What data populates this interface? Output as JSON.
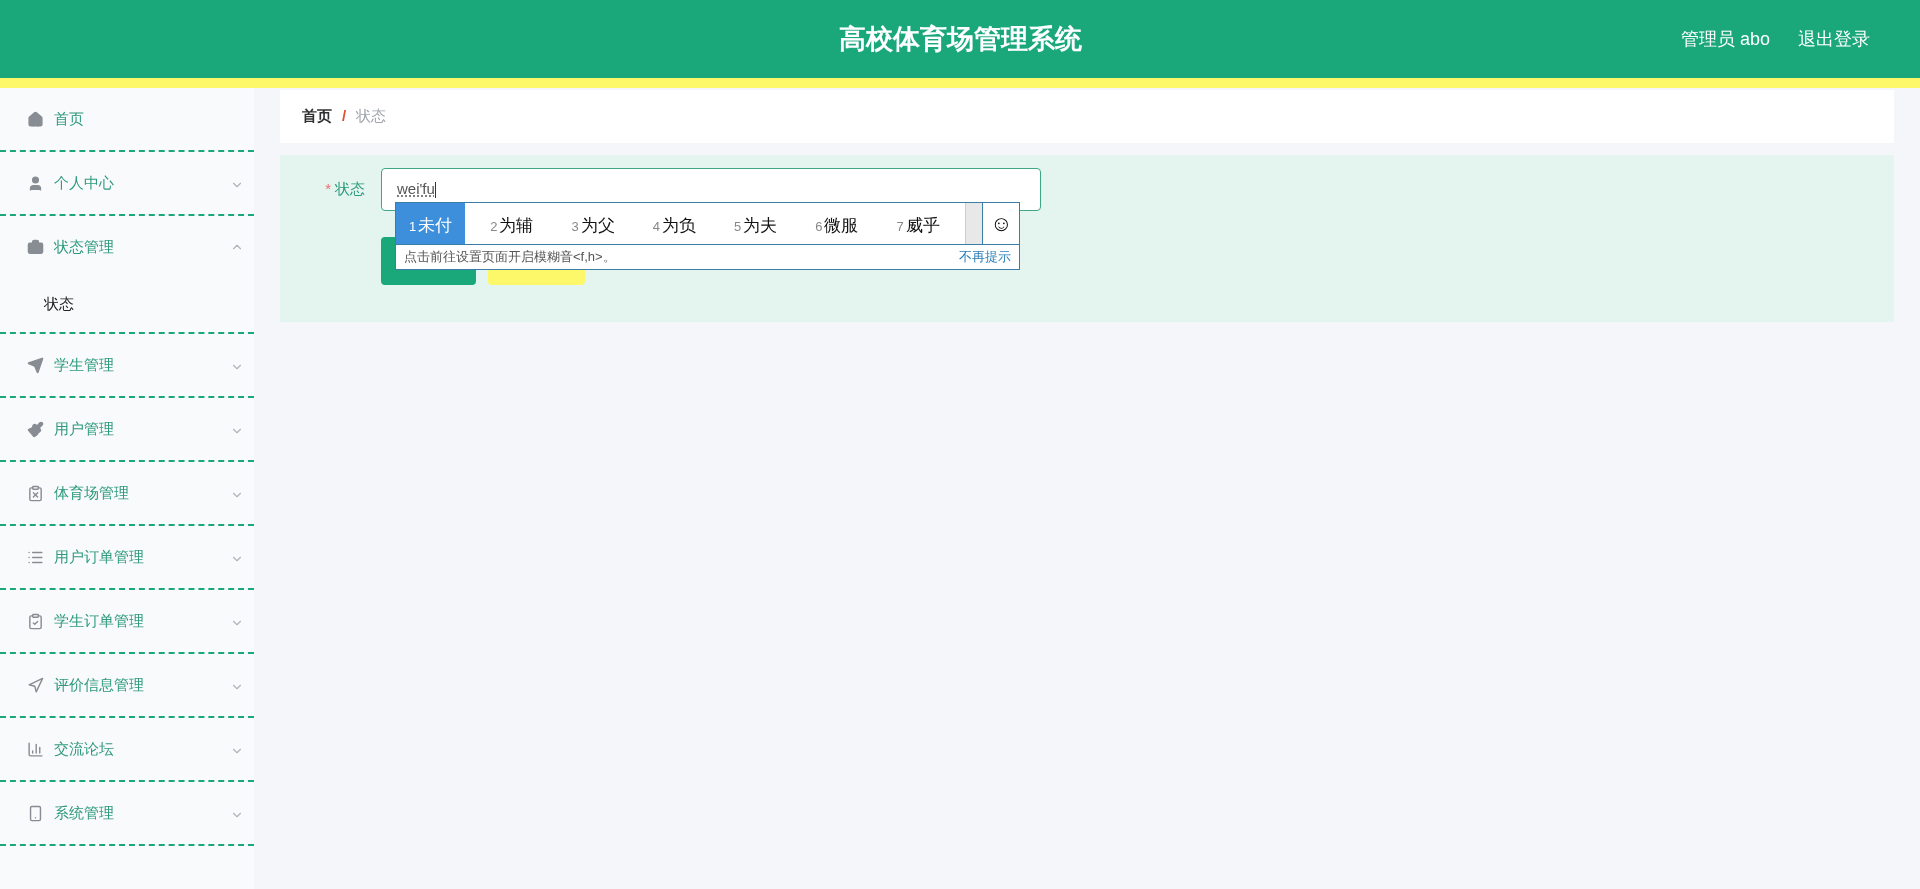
{
  "header": {
    "title": "高校体育场管理系统",
    "user": "管理员 abo",
    "logout": "退出登录"
  },
  "sidebar": {
    "items": [
      {
        "label": "首页"
      },
      {
        "label": "个人中心",
        "expanded": false
      },
      {
        "label": "状态管理",
        "expanded": true,
        "children": [
          {
            "label": "状态"
          }
        ]
      },
      {
        "label": "学生管理",
        "expanded": false
      },
      {
        "label": "用户管理",
        "expanded": false
      },
      {
        "label": "体育场管理",
        "expanded": false
      },
      {
        "label": "用户订单管理",
        "expanded": false
      },
      {
        "label": "学生订单管理",
        "expanded": false
      },
      {
        "label": "评价信息管理",
        "expanded": false
      },
      {
        "label": "交流论坛",
        "expanded": false
      },
      {
        "label": "系统管理",
        "expanded": false
      }
    ]
  },
  "breadcrumb": [
    {
      "label": "首页"
    },
    {
      "label": "状态"
    }
  ],
  "breadcrumb_separator": "/",
  "form": {
    "fields": [
      {
        "label": "状态",
        "required_mark": "*",
        "value": "wei'fu"
      }
    ]
  },
  "ime": {
    "candidates": [
      {
        "number": "1",
        "text": "未付",
        "selected": true
      },
      {
        "number": "2",
        "text": "为辅",
        "selected": false
      },
      {
        "number": "3",
        "text": "为父",
        "selected": false
      },
      {
        "number": "4",
        "text": "为负",
        "selected": false
      },
      {
        "number": "5",
        "text": "为夫",
        "selected": false
      },
      {
        "number": "6",
        "text": "微服",
        "selected": false
      },
      {
        "number": "7",
        "text": "威乎",
        "selected": false
      }
    ],
    "emoji": "☺",
    "hint": "点击前往设置页面开启模糊音<f,h>。",
    "dismiss": "不再提示"
  }
}
